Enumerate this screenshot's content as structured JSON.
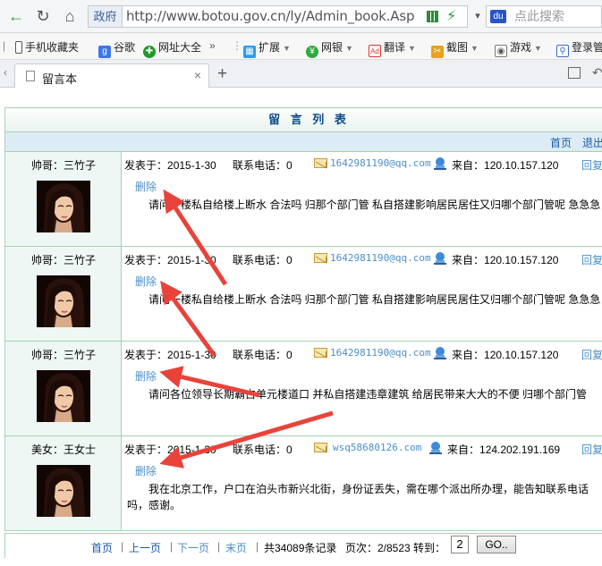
{
  "browser": {
    "address": {
      "site_label": "政府",
      "url": "http://www.botou.gov.cn/ly/Admin_book.Asp"
    },
    "search_placeholder": "点此搜索",
    "bookmarks": [
      {
        "label": "手机收藏夹",
        "icon": "mobile-icon"
      },
      {
        "label": "谷歌",
        "icon": "google-icon"
      },
      {
        "label": "网址大全",
        "icon": "hao-icon"
      },
      {
        "label": "扩展",
        "icon": "extension-icon"
      },
      {
        "label": "网银",
        "icon": "bank-icon"
      },
      {
        "label": "翻译",
        "icon": "translate-icon"
      },
      {
        "label": "截图",
        "icon": "screenshot-icon"
      },
      {
        "label": "游戏",
        "icon": "game-icon"
      },
      {
        "label": "登录管",
        "icon": "login-icon"
      }
    ],
    "tab_title": "留言本"
  },
  "guestbook": {
    "title": "留 言 列 表",
    "first_page": "首页",
    "logout": "退出",
    "posted_label": "发表于：",
    "phone_label": "联系电话：",
    "from_label": "来自：",
    "reply_label": "回复",
    "delete_label": "删除",
    "entries": [
      {
        "user": "帅哥：三竹子",
        "date": "2015-1-30",
        "phone": "0",
        "email": "1642981190@qq.com",
        "ip": "120.10.157.120",
        "message": "请问一楼私自给楼上断水 合法吗 归那个部门管 私自搭建影响居民居住又归哪个部门管呢 急急急"
      },
      {
        "user": "帅哥：三竹子",
        "date": "2015-1-30",
        "phone": "0",
        "email": "1642981190@qq.com",
        "ip": "120.10.157.120",
        "message": "请问一楼私自给楼上断水 合法吗 归那个部门管 私自搭建影响居民居住又归哪个部门管呢 急急急"
      },
      {
        "user": "帅哥：三竹子",
        "date": "2015-1-30",
        "phone": "0",
        "email": "1642981190@qq.com",
        "ip": "120.10.157.120",
        "message": "请问各位领导长期霸占单元楼道口 并私自搭建违章建筑 给居民带来大大的不便 归哪个部门管"
      },
      {
        "user": "美女：王女士",
        "date": "2015-1-30",
        "phone": "0",
        "email": "wsq58680126.com",
        "ip": "124.202.191.169",
        "message": "我在北京工作，户口在泊头市新兴北街，身份证丢失，需在哪个派出所办理，能告知联系电话吗，感谢。"
      }
    ],
    "pagination": {
      "first": "首页",
      "prev": "上一页",
      "next": "下一页",
      "last": "末页",
      "total_text": "共34089条记录",
      "page_text": "页次：2/8523",
      "goto_label": "转到：",
      "page_input": "2",
      "go_label": "GO.."
    }
  },
  "colors": {
    "annotation_arrow": "#e8433b",
    "link_blue": "#4a8fc9",
    "title_blue": "#0b4a8a",
    "border_green": "#a7d0b3"
  }
}
